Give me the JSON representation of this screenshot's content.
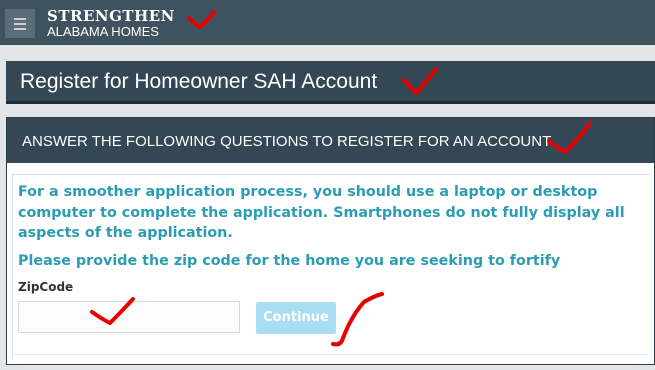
{
  "header": {
    "brand_line1": "STRENGTHEN",
    "brand_line2": "ALABAMA HOMES",
    "menu_icon": "hamburger-menu-icon"
  },
  "page": {
    "title": "Register for Homeowner SAH Account"
  },
  "card": {
    "heading": "ANSWER THE FOLLOWING QUESTIONS TO REGISTER FOR AN ACCOUNT",
    "notice": "For a smoother application process, you should use a laptop or desktop computer to complete the application. Smartphones do not fully display all aspects of the application.",
    "prompt": "Please provide the zip code for the home you are seeking to fortify",
    "zip_label": "ZipCode",
    "zip_value": "",
    "zip_placeholder": "",
    "continue_label": "Continue"
  },
  "colors": {
    "topbar": "#3f5260",
    "header_dark": "#344754",
    "accent_text": "#2a9cb4",
    "button_disabled": "#a8ddf2",
    "annotation_red": "#e60000"
  }
}
